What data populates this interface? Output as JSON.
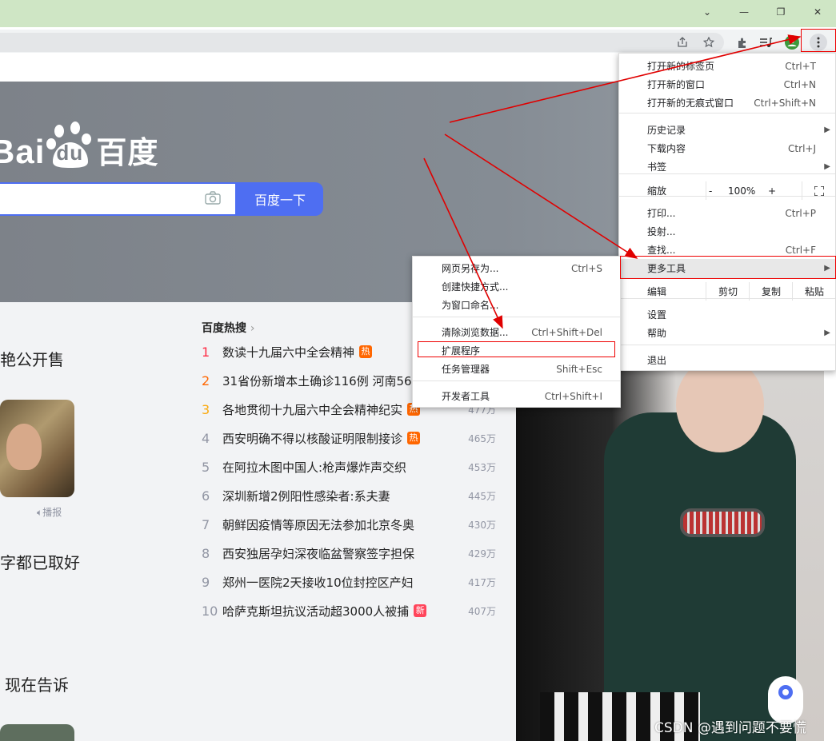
{
  "window": {
    "controls": [
      "⌄",
      "—",
      "❐",
      "✕"
    ]
  },
  "baidu": {
    "logo_text": "Bai",
    "logo_paw": "du",
    "logo_cn": "百度",
    "search_button": "百度一下",
    "hot_header": "百度热搜",
    "hot_items": [
      {
        "rank": "1",
        "title": "数读十九届六中全会精神",
        "badge": "热",
        "count": ""
      },
      {
        "rank": "2",
        "title": "31省份新增本土确诊116例 河南56",
        "badge": "",
        "count": ""
      },
      {
        "rank": "3",
        "title": "各地贯彻十九届六中全会精神纪实",
        "badge": "热",
        "count": "477万"
      },
      {
        "rank": "4",
        "title": "西安明确不得以核酸证明限制接诊",
        "badge": "热",
        "count": "465万"
      },
      {
        "rank": "5",
        "title": "在阿拉木图中国人:枪声爆炸声交织",
        "badge": "",
        "count": "453万"
      },
      {
        "rank": "6",
        "title": "深圳新增2例阳性感染者:系夫妻",
        "badge": "",
        "count": "445万"
      },
      {
        "rank": "7",
        "title": "朝鲜因疫情等原因无法参加北京冬奥",
        "badge": "",
        "count": "430万"
      },
      {
        "rank": "8",
        "title": "西安独居孕妇深夜临盆警察签字担保",
        "badge": "",
        "count": "429万"
      },
      {
        "rank": "9",
        "title": "郑州一医院2天接收10位封控区产妇",
        "badge": "",
        "count": "417万"
      },
      {
        "rank": "10",
        "title": "哈萨克斯坦抗议活动超3000人被捕",
        "badge": "新",
        "count": "407万"
      }
    ],
    "feed_texts": [
      "艳公开售",
      "字都已取好",
      "现在告诉"
    ],
    "broadcast_label": "播报"
  },
  "menu": {
    "items": [
      {
        "label": "打开新的标签页",
        "shortcut": "Ctrl+T"
      },
      {
        "label": "打开新的窗口",
        "shortcut": "Ctrl+N"
      },
      {
        "label": "打开新的无痕式窗口",
        "shortcut": "Ctrl+Shift+N"
      },
      {
        "label": "历史记录",
        "shortcut": ""
      },
      {
        "label": "下载内容",
        "shortcut": "Ctrl+J"
      },
      {
        "label": "书签",
        "shortcut": ""
      },
      {
        "label": "缩放",
        "shortcut": ""
      },
      {
        "label": "打印...",
        "shortcut": "Ctrl+P"
      },
      {
        "label": "投射...",
        "shortcut": ""
      },
      {
        "label": "查找...",
        "shortcut": "Ctrl+F"
      },
      {
        "label": "更多工具",
        "shortcut": ""
      },
      {
        "label": "编辑",
        "shortcut": ""
      },
      {
        "label": "设置",
        "shortcut": ""
      },
      {
        "label": "帮助",
        "shortcut": ""
      },
      {
        "label": "退出",
        "shortcut": ""
      }
    ],
    "zoom_minus": "-",
    "zoom_value": "100%",
    "zoom_plus": "+",
    "edit_cut": "剪切",
    "edit_copy": "复制",
    "edit_paste": "粘贴"
  },
  "submenu": {
    "items": [
      {
        "label": "网页另存为...",
        "shortcut": "Ctrl+S"
      },
      {
        "label": "创建快捷方式...",
        "shortcut": ""
      },
      {
        "label": "为窗口命名...",
        "shortcut": ""
      },
      {
        "label": "清除浏览数据...",
        "shortcut": "Ctrl+Shift+Del"
      },
      {
        "label": "扩展程序",
        "shortcut": ""
      },
      {
        "label": "任务管理器",
        "shortcut": "Shift+Esc"
      },
      {
        "label": "开发者工具",
        "shortcut": "Ctrl+Shift+I"
      }
    ]
  },
  "watermark": "CSDN @遇到问题不要慌",
  "colors": {
    "accent": "#4e6ef2",
    "annotation": "#e00000",
    "hot": "#ff6600",
    "new": "#ff455b"
  }
}
